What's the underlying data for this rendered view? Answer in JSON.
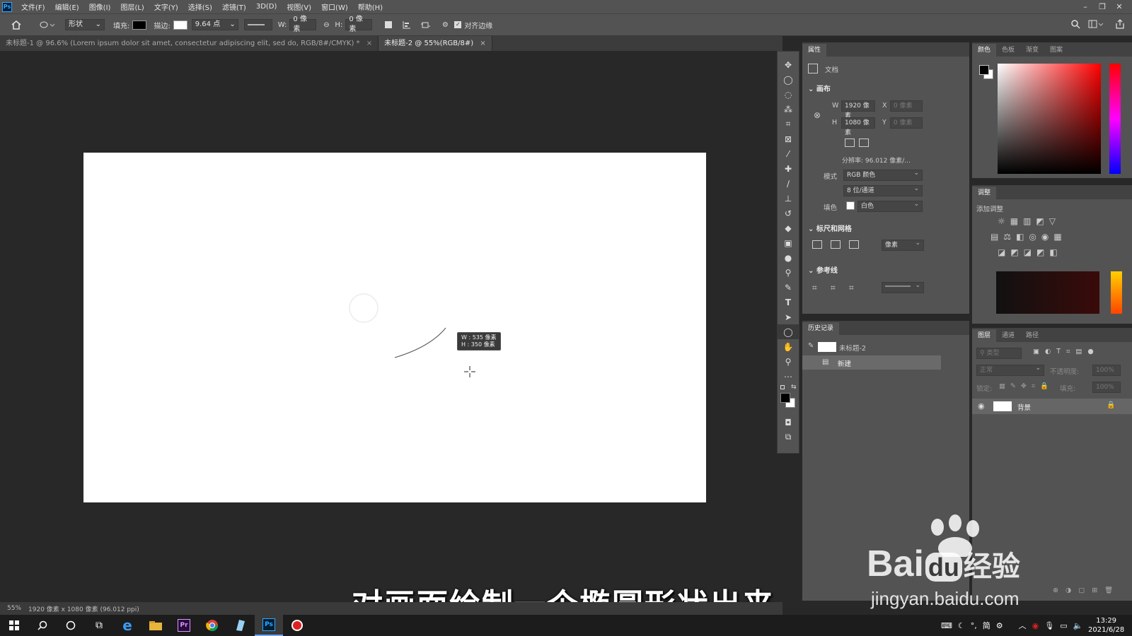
{
  "app": {
    "logo": "Ps"
  },
  "menu": [
    "文件(F)",
    "编辑(E)",
    "图像(I)",
    "图层(L)",
    "文字(Y)",
    "选择(S)",
    "滤镜(T)",
    "3D(D)",
    "视图(V)",
    "窗口(W)",
    "帮助(H)"
  ],
  "options": {
    "shape_mode": "形状",
    "fill_label": "填充:",
    "stroke_label": "描边:",
    "stroke_width": "9.64 点",
    "w_label": "W:",
    "w_value": "0 像素",
    "h_label": "H:",
    "h_value": "0 像素",
    "align_edges": "对齐边缘"
  },
  "tabs": [
    {
      "label": "未标题-1 @ 96.6% (Lorem ipsum dolor sit amet, consectetur adipiscing elit, sed do, RGB/8#/CMYK) *",
      "active": false
    },
    {
      "label": "未标题-2 @ 55%(RGB/8#)",
      "active": true
    }
  ],
  "tooltip": {
    "w": "W : 535 像素",
    "h": "H : 350 像素"
  },
  "status": {
    "zoom": "55%",
    "doc_size": "1920 像素 x 1080 像素 (96.012 ppi)"
  },
  "properties": {
    "tab": "属性",
    "doc_label": "文档",
    "canvas_section": "画布",
    "w_label": "W",
    "w_value": "1920 像素",
    "h_label": "H",
    "h_value": "1080 像素",
    "x_label": "X",
    "x_value": "0 像素",
    "y_label": "Y",
    "y_value": "0 像素",
    "resolution": "分辨率: 96.012 像素/...",
    "mode_label": "模式",
    "mode_value": "RGB 颜色",
    "depth_value": "8 位/通道",
    "fill_label": "填色",
    "fill_value": "白色",
    "rulers_section": "标尺和网格",
    "ruler_unit": "像素",
    "guides_section": "参考线"
  },
  "history": {
    "tab": "历史记录",
    "snapshot": "未标题-2",
    "items": [
      "新建"
    ]
  },
  "color_panel": {
    "tabs": [
      "颜色",
      "色板",
      "渐变",
      "图案"
    ]
  },
  "adjust_panel": {
    "tab": "调整",
    "add_label": "添加调整"
  },
  "layers_panel": {
    "tabs": [
      "图层",
      "通道",
      "路径"
    ],
    "search_placeholder": "类型",
    "blend_mode": "正常",
    "opacity_label": "不透明度:",
    "opacity_value": "100%",
    "lock_label": "锁定:",
    "fill_label": "填充:",
    "fill_value": "100%",
    "layers": [
      {
        "name": "背景",
        "locked": true,
        "visible": true
      }
    ]
  },
  "subtitle": "对画面绘制一个椭圆形状出来",
  "watermark": {
    "brand": "Bai",
    "brand2": "du",
    "brand_cn": "经验",
    "url": "jingyan.baidu.com"
  },
  "taskbar": {
    "time": "13:29",
    "date": "2021/6/28",
    "ime": "简"
  },
  "colors": {
    "accent": "#31a8ff",
    "panel_bg": "#535353",
    "workspace_bg": "#282828"
  }
}
